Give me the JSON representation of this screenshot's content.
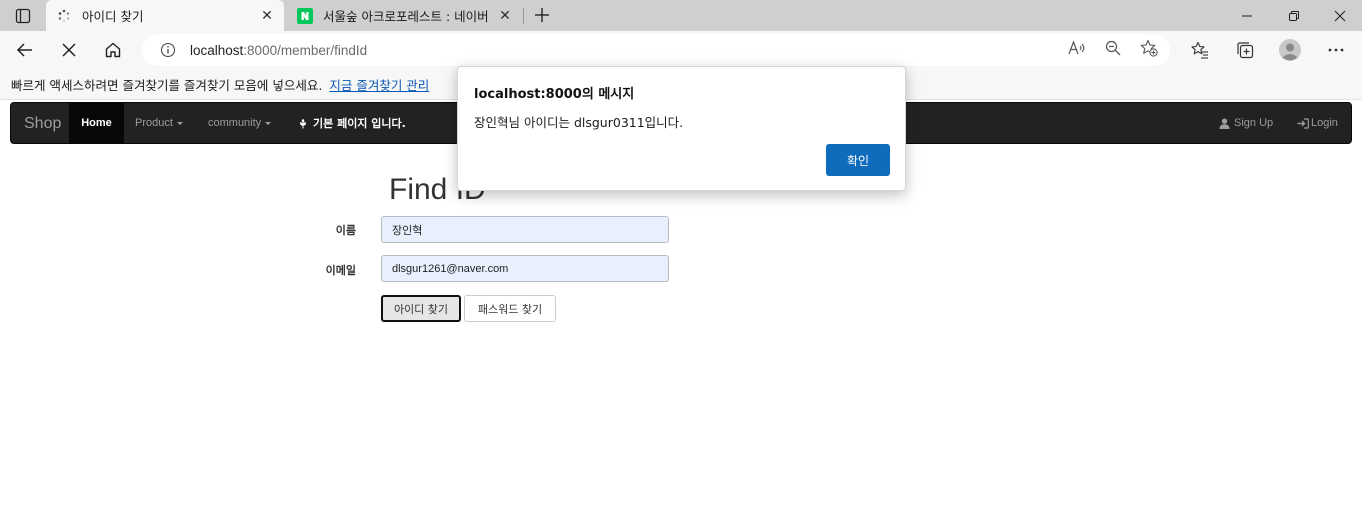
{
  "browser": {
    "tabs": [
      {
        "title": "아이디 찾기",
        "active": true
      },
      {
        "title": "서울숲 아크로포레스트 : 네이버",
        "active": false
      }
    ],
    "address": {
      "host": "localhost",
      "path": ":8000/member/findId"
    },
    "favorites_bar": {
      "message": "빠르게 액세스하려면 즐겨찾기를 즐겨찾기 모음에 넣으세요.",
      "link": "지금 즐겨찾기 관리"
    }
  },
  "navbar": {
    "brand": "Shop",
    "home": "Home",
    "product": "Product",
    "community": "community",
    "basic_page": "기본 페이지 입니다.",
    "signup": "Sign Up",
    "login": "Login"
  },
  "form": {
    "title": "Find ID",
    "name_label": "이름",
    "name_value": "장인혁",
    "email_label": "이메일",
    "email_value": "dlsgur1261@naver.com",
    "find_id_button": "아이디 찾기",
    "find_pw_button": "패스워드 찾기"
  },
  "dialog": {
    "title": "localhost:8000의 메시지",
    "message": "장인혁님 아이디는 dlsgur0311입니다.",
    "ok_button": "확인"
  },
  "colors": {
    "navbar_bg": "#222222",
    "dialog_button": "#0f6cbd",
    "favorites_link": "#0a58b5"
  }
}
